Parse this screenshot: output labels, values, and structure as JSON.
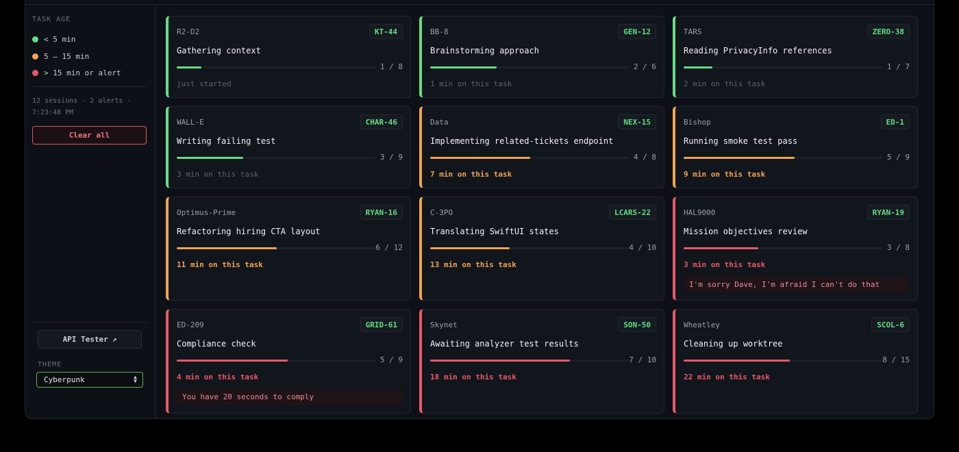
{
  "sidebar": {
    "task_age_heading": "TASK AGE",
    "legend": [
      {
        "label": "< 5 min",
        "color": "#62de84"
      },
      {
        "label": "5 – 15 min",
        "color": "#f2a44c"
      },
      {
        "label": "> 15 min or alert",
        "color": "#ea5868"
      }
    ],
    "stats_line1": "12 sessions · 2 alerts ·",
    "stats_line2": "7:23:48 PM",
    "clear_label": "Clear all",
    "api_tester_label": "API Tester",
    "api_tester_icon": "↗",
    "theme_label": "THEME",
    "theme_value": "Cyberpunk"
  },
  "cards": [
    {
      "agent": "R2-D2",
      "ticket": "KT-44",
      "task": "Gathering context",
      "done": 1,
      "total": 8,
      "progress": "1 / 8",
      "age": "just started",
      "status": "green",
      "alert": ""
    },
    {
      "agent": "BB-8",
      "ticket": "GEN-12",
      "task": "Brainstorming approach",
      "done": 2,
      "total": 6,
      "progress": "2 / 6",
      "age": "1 min on this task",
      "status": "green",
      "alert": ""
    },
    {
      "agent": "TARS",
      "ticket": "ZERO-38",
      "task": "Reading PrivacyInfo references",
      "done": 1,
      "total": 7,
      "progress": "1 / 7",
      "age": "2 min on this task",
      "status": "green",
      "alert": ""
    },
    {
      "agent": "WALL-E",
      "ticket": "CHAR-46",
      "task": "Writing failing test",
      "done": 3,
      "total": 9,
      "progress": "3 / 9",
      "age": "3 min on this task",
      "status": "green",
      "alert": ""
    },
    {
      "agent": "Data",
      "ticket": "NEX-15",
      "task": "Implementing related-tickets endpoint",
      "done": 4,
      "total": 8,
      "progress": "4 / 8",
      "age": "7 min on this task",
      "status": "amber",
      "alert": ""
    },
    {
      "agent": "Bishop",
      "ticket": "ED-1",
      "task": "Running smoke test pass",
      "done": 5,
      "total": 9,
      "progress": "5 / 9",
      "age": "9 min on this task",
      "status": "amber",
      "alert": ""
    },
    {
      "agent": "Optimus-Prime",
      "ticket": "RYAN-16",
      "task": "Refactoring hiring CTA layout",
      "done": 6,
      "total": 12,
      "progress": "6 / 12",
      "age": "11 min on this task",
      "status": "amber",
      "alert": ""
    },
    {
      "agent": "C-3PO",
      "ticket": "LCARS-22",
      "task": "Translating SwiftUI states",
      "done": 4,
      "total": 10,
      "progress": "4 / 10",
      "age": "13 min on this task",
      "status": "amber",
      "alert": ""
    },
    {
      "agent": "HAL9000",
      "ticket": "RYAN-19",
      "task": "Mission objectives review",
      "done": 3,
      "total": 8,
      "progress": "3 / 8",
      "age": "3 min on this task",
      "status": "red",
      "alert": "I'm sorry Dave, I'm afraid I can't do that"
    },
    {
      "agent": "ED-209",
      "ticket": "GRID-61",
      "task": "Compliance check",
      "done": 5,
      "total": 9,
      "progress": "5 / 9",
      "age": "4 min on this task",
      "status": "red",
      "alert": "You have 20 seconds to comply"
    },
    {
      "agent": "Skynet",
      "ticket": "SON-50",
      "task": "Awaiting analyzer test results",
      "done": 7,
      "total": 10,
      "progress": "7 / 10",
      "age": "18 min on this task",
      "status": "red",
      "alert": ""
    },
    {
      "agent": "Wheatley",
      "ticket": "SCOL-6",
      "task": "Cleaning up worktree",
      "done": 8,
      "total": 15,
      "progress": "8 / 15",
      "age": "22 min on this task",
      "status": "red",
      "alert": ""
    }
  ]
}
